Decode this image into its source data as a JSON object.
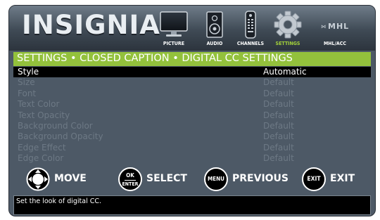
{
  "header": {
    "logo": "INSIGNIA",
    "menu": [
      {
        "label": "PICTURE",
        "icon": "tv-icon",
        "active": false
      },
      {
        "label": "AUDIO",
        "icon": "speaker-icon",
        "active": false
      },
      {
        "label": "CHANNELS",
        "icon": "remote-icon",
        "active": false
      },
      {
        "label": "SETTINGS",
        "icon": "gear-icon",
        "active": true
      },
      {
        "label": "MHL/ACC",
        "icon": "mhl-logo-icon",
        "active": false,
        "logo_text": "MHL"
      }
    ]
  },
  "breadcrumb": "SETTINGS • CLOSED CAPTION • DIGITAL CC SETTINGS",
  "settings": [
    {
      "label": "Style",
      "value": "Automatic",
      "selected": true
    },
    {
      "label": "Size",
      "value": "Default",
      "selected": false
    },
    {
      "label": "Font",
      "value": "Default",
      "selected": false
    },
    {
      "label": "Text Color",
      "value": "Default",
      "selected": false
    },
    {
      "label": "Text Opacity",
      "value": "Default",
      "selected": false
    },
    {
      "label": "Background Color",
      "value": "Default",
      "selected": false
    },
    {
      "label": "Background Opacity",
      "value": "Default",
      "selected": false
    },
    {
      "label": "Edge Effect",
      "value": "Default",
      "selected": false
    },
    {
      "label": "Edge Color",
      "value": "Default",
      "selected": false
    }
  ],
  "nav": {
    "move": {
      "label": "MOVE"
    },
    "select": {
      "label": "SELECT",
      "button_top": "OK",
      "button_bottom": "ENTER"
    },
    "previous": {
      "label": "PREVIOUS",
      "button": "MENU"
    },
    "exit": {
      "label": "EXIT",
      "button": "EXIT"
    }
  },
  "help_text": "Set the look of digital CC.",
  "colors": {
    "accent_green": "#93c13c",
    "active_menu_label": "#a3d23a",
    "panel": "#4d5966",
    "selected_row": "#000000",
    "dim_text": "#6d7985"
  }
}
